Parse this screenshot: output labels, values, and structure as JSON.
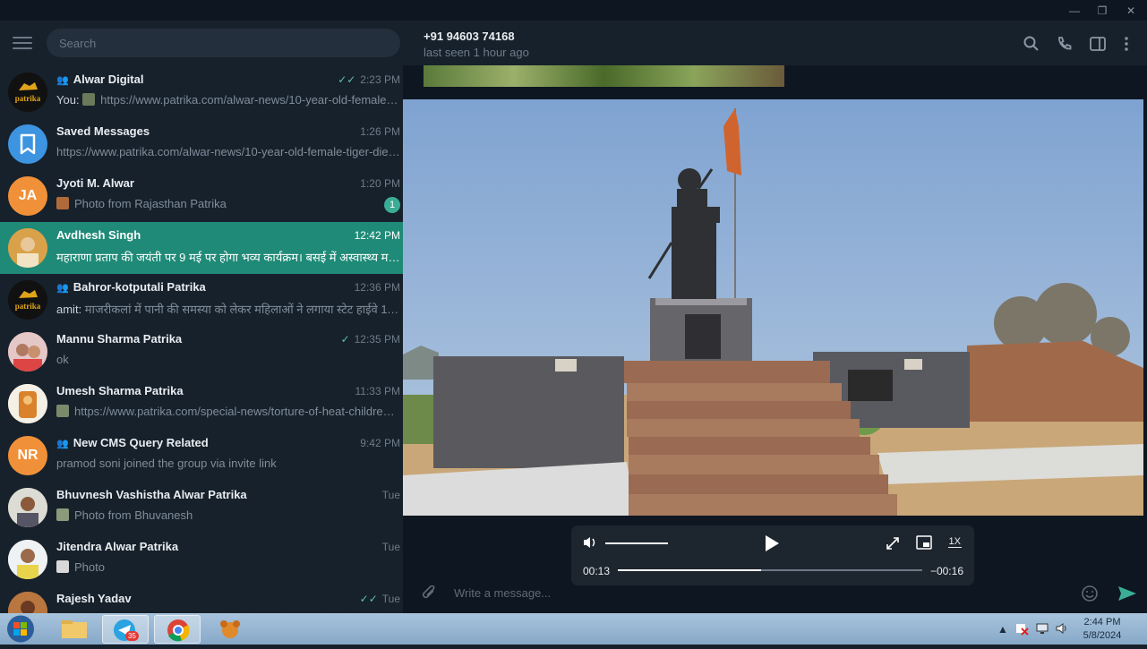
{
  "sidebar": {
    "search_placeholder": "Search",
    "chats": [
      {
        "name": "Alwar Digital",
        "group": true,
        "time": "2:23 PM",
        "read": true,
        "prefix": "You: ",
        "preview": "https://www.patrika.com/alwar-news/10-year-old-female-ti...",
        "avatar_text": "patrika"
      },
      {
        "name": "Saved Messages",
        "group": false,
        "time": "1:26 PM",
        "preview": "https://www.patrika.com/alwar-news/10-year-old-female-tiger-died..."
      },
      {
        "name": "Jyoti M. Alwar",
        "group": false,
        "time": "1:20 PM",
        "preview": "Photo from Rajasthan Patrika",
        "avatar_text": "JA",
        "unread": "1"
      },
      {
        "name": "Avdhesh Singh",
        "group": false,
        "time": "12:42 PM",
        "preview": "महाराणा प्रताप की जयंती पर 9 मई पर होगा भव्य कार्यक्रम। बसई में अस्वास्थ्य महाराणा..."
      },
      {
        "name": "Bahror-kotputali Patrika",
        "group": true,
        "time": "12:36 PM",
        "prefix": "amit: ",
        "preview": "माजरीकलां में पानी की समस्या को लेकर महिलाओं ने लगाया स्टेट हाईवे 111 जा...",
        "avatar_text": "patrika"
      },
      {
        "name": "Mannu Sharma Patrika",
        "group": false,
        "time": "12:35 PM",
        "read": true,
        "preview": "ok"
      },
      {
        "name": "Umesh Sharma Patrika",
        "group": false,
        "time": "11:33 PM",
        "preview": "https://www.patrika.com/special-news/torture-of-heat-children-..."
      },
      {
        "name": "New CMS Query Related",
        "group": true,
        "time": "9:42 PM",
        "preview": "pramod soni joined the group via invite link",
        "avatar_text": "NR"
      },
      {
        "name": "Bhuvnesh Vashistha Alwar Patrika",
        "group": false,
        "time": "Tue",
        "preview": "Photo from Bhuvanesh"
      },
      {
        "name": "Jitendra Alwar Patrika",
        "group": false,
        "time": "Tue",
        "preview": "Photo"
      },
      {
        "name": "Rajesh Yadav",
        "group": false,
        "time": "Tue",
        "read": true,
        "preview": ""
      }
    ]
  },
  "header": {
    "name": "+91 94603 74168",
    "status": "last seen 1 hour ago"
  },
  "player": {
    "current": "00:13",
    "remaining": "−00:16",
    "speed": "1X",
    "progress": 0.47,
    "volume": 1.0
  },
  "composer": {
    "placeholder": "Write a message..."
  },
  "taskbar": {
    "time": "2:44 PM",
    "date": "5/8/2024",
    "telegram_badge": "35"
  },
  "colors": {
    "accent": "#1f8a77",
    "sidebar_bg": "#17212b",
    "chat_bg": "#0e1621"
  }
}
